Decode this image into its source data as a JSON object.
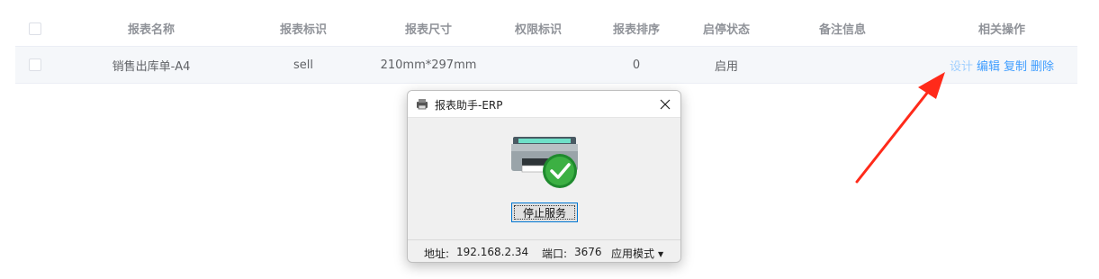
{
  "table": {
    "headers": [
      "报表名称",
      "报表标识",
      "报表尺寸",
      "权限标识",
      "报表排序",
      "启停状态",
      "备注信息",
      "相关操作"
    ],
    "rows": [
      {
        "name": "销售出库单-A4",
        "code": "sell",
        "size": "210mm*297mm",
        "permission": "",
        "sort": "0",
        "status": "启用",
        "remark": "",
        "actions": [
          "设计",
          "编辑",
          "复制",
          "删除"
        ]
      }
    ]
  },
  "colors": {
    "accent": "#409eff",
    "arrow": "#ff2a1a"
  },
  "dialog": {
    "title": "报表助手-ERP",
    "stop_button": "停止服务",
    "status": {
      "address_label": "地址:",
      "address": "192.168.2.34",
      "port_label": "端口:",
      "port": "3676",
      "mode": "应用模式"
    }
  },
  "icons": [
    "checkbox",
    "printer-icon",
    "check-badge-icon",
    "close-icon",
    "arrow-annotation",
    "dropdown-caret-icon"
  ]
}
